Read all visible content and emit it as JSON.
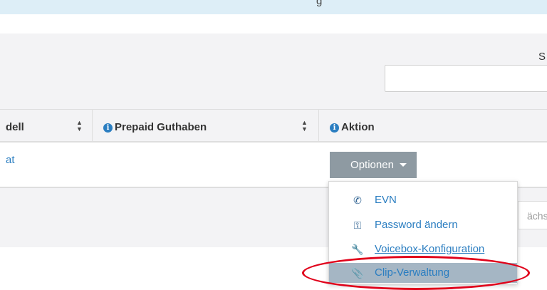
{
  "top_strip": {
    "text": "g"
  },
  "search": {
    "label": "S",
    "placeholder": ""
  },
  "table": {
    "columns": [
      {
        "label": "dell",
        "sortable": true
      },
      {
        "label": "Prepaid Guthaben",
        "sortable": true,
        "info": true
      },
      {
        "label": "Aktion",
        "sortable": false,
        "info": true
      }
    ],
    "row": {
      "model_link": "at",
      "options_label": "Optionen"
    }
  },
  "pager": {
    "next_label": "ächst"
  },
  "dropdown": {
    "items": [
      {
        "label": "EVN",
        "icon": "phone-icon",
        "active": false
      },
      {
        "label": "Password ändern",
        "icon": "key-icon",
        "active": false
      },
      {
        "label": "Voicebox-Konfiguration",
        "icon": "wrench-icon",
        "active": false
      },
      {
        "label": "Clip-Verwaltung",
        "icon": "paperclip-icon",
        "active": true
      }
    ]
  },
  "colors": {
    "link": "#2b7ec1",
    "button": "#8e9aa2",
    "highlight": "#e0001a",
    "active_item": "#a5b6c4"
  }
}
